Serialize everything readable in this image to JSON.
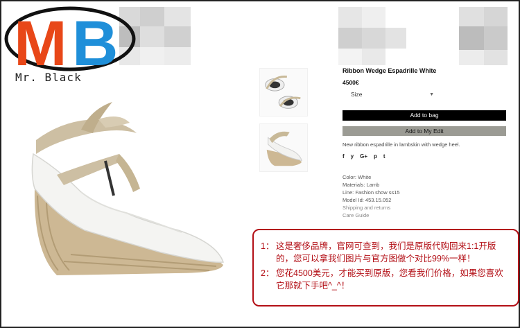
{
  "logo": {
    "letters": "MB",
    "subtitle": "Mr. Black"
  },
  "product": {
    "title": "Ribbon Wedge Espadrille White",
    "price": "4500€",
    "size_label": "Size",
    "add_to_bag": "Add to bag",
    "add_to_edit": "Add to My Edit",
    "description": "New ribbon espadrille in lambskin with wedge heel.",
    "social": [
      "f",
      "y",
      "G+",
      "p",
      "t"
    ],
    "details": {
      "color": "Color: White",
      "materials": "Materials: Lamb",
      "line": "Line: Fashion show ss15",
      "model": "Model Id: 453.15.052"
    },
    "links": {
      "shipping": "Shipping and returns",
      "care": "Care Guide"
    }
  },
  "note": {
    "item1_num": "1：",
    "item1_text": "这是奢侈品牌，官网可查到，我们是原版代购回来1:1开版的，您可以拿我们图片与官方图做个对比99%一样！",
    "item2_num": "2：",
    "item2_text": "您花4500美元，才能买到原版，您看我们价格，如果您喜欢它那就下手吧^_^！"
  },
  "colors": {
    "note_red": "#b30f16",
    "logo_red": "#e84718",
    "logo_blue": "#1f8fd9"
  }
}
